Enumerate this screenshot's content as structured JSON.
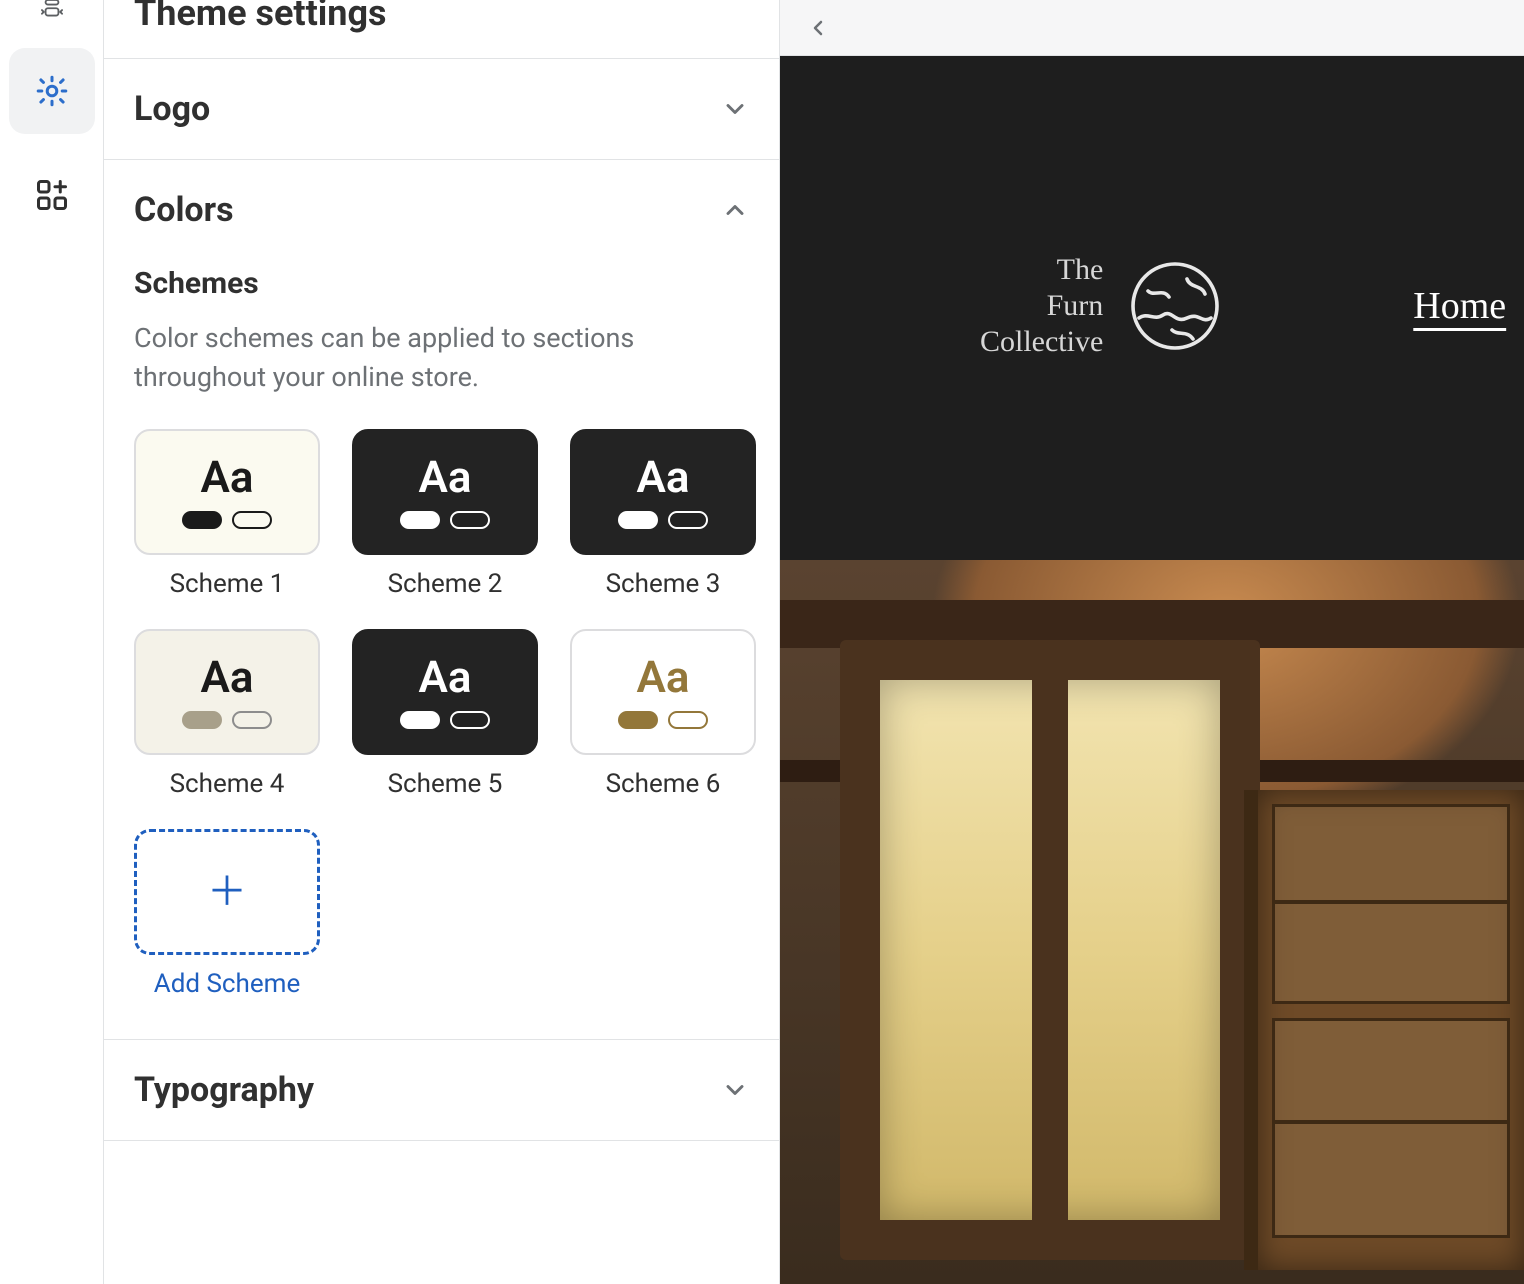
{
  "panel": {
    "title": "Theme settings",
    "sections": {
      "logo": {
        "label": "Logo",
        "expanded": false
      },
      "colors": {
        "label": "Colors",
        "expanded": true,
        "subheading": "Schemes",
        "description": "Color schemes can be applied to sections throughout your online store.",
        "add_label": "Add Scheme"
      },
      "typography": {
        "label": "Typography",
        "expanded": false
      }
    }
  },
  "schemes": [
    {
      "label": "Scheme 1",
      "bg": "#fbfaf0",
      "text": "#1a1a1a",
      "pill_fill": "#1a1a1a",
      "pill_outline": "#1a1a1a"
    },
    {
      "label": "Scheme 2",
      "bg": "#232323",
      "text": "#ffffff",
      "pill_fill": "#ffffff",
      "pill_outline": "#ffffff"
    },
    {
      "label": "Scheme 3",
      "bg": "#232323",
      "text": "#ffffff",
      "pill_fill": "#ffffff",
      "pill_outline": "#ffffff"
    },
    {
      "label": "Scheme 4",
      "bg": "#f4f2e8",
      "text": "#1a1a1a",
      "pill_fill": "#a8a08a",
      "pill_outline": "#8d8d8d"
    },
    {
      "label": "Scheme 5",
      "bg": "#232323",
      "text": "#ffffff",
      "pill_fill": "#ffffff",
      "pill_outline": "#ffffff"
    },
    {
      "label": "Scheme 6",
      "bg": "#ffffff",
      "text": "#93773a",
      "pill_fill": "#93773a",
      "pill_outline": "#93773a"
    }
  ],
  "rail": {
    "items": [
      "sections-icon",
      "settings-icon",
      "apps-icon"
    ],
    "active_index": 1
  },
  "preview": {
    "brand_lines": [
      "The",
      "Furn",
      "Collective"
    ],
    "nav": [
      "Home"
    ]
  }
}
